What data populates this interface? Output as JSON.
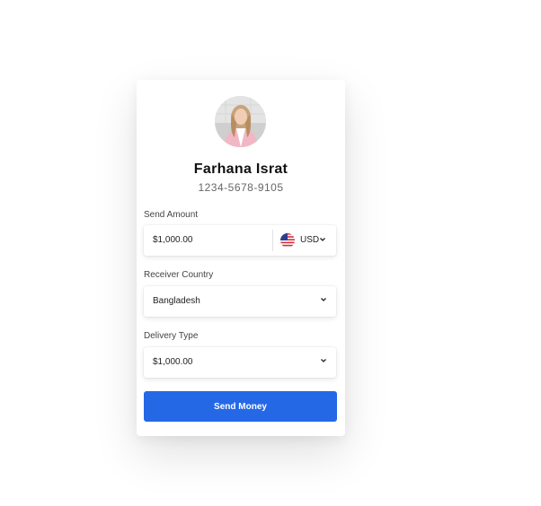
{
  "profile": {
    "name": "Farhana Israt",
    "account_number": "1234-5678-9105"
  },
  "send_amount": {
    "label": "Send Amount",
    "value": "$1,000.00",
    "currency": {
      "code": "USD",
      "flag_icon": "us-flag-icon"
    }
  },
  "receiver_country": {
    "label": "Receiver Country",
    "value": "Bangladesh"
  },
  "delivery_type": {
    "label": "Delivery Type",
    "value": "$1,000.00"
  },
  "actions": {
    "send_label": "Send Money"
  },
  "colors": {
    "primary": "#2468e6",
    "background": "#ffffff",
    "text": "#111111",
    "muted_text": "#666666"
  }
}
